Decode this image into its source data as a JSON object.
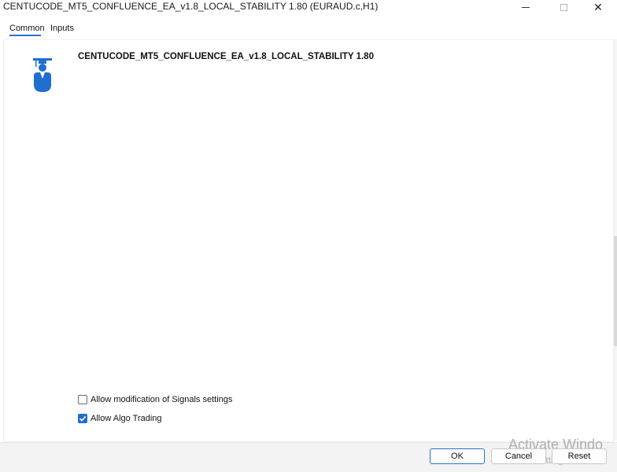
{
  "window": {
    "title": "CENTUCODE_MT5_CONFLUENCE_EA_v1.8_LOCAL_STABILITY 1.80 (EURAUD.c,H1)"
  },
  "tabs": [
    {
      "label": "Common",
      "active": true
    },
    {
      "label": "Inputs",
      "active": false
    }
  ],
  "expert": {
    "name": "CENTUCODE_MT5_CONFLUENCE_EA_v1.8_LOCAL_STABILITY 1.80",
    "icon": "expert-advisor-icon"
  },
  "options": [
    {
      "label": "Allow modification of Signals settings",
      "checked": false
    },
    {
      "label": "Allow Algo Trading",
      "checked": true
    }
  ],
  "buttons": {
    "ok": "OK",
    "cancel": "Cancel",
    "reset": "Reset"
  },
  "watermark": {
    "line1": "Activate Windo",
    "line2": "Go to Settings to acti"
  },
  "colors": {
    "accent": "#1f6fd1",
    "icon_blue": "#1f6fd1"
  }
}
